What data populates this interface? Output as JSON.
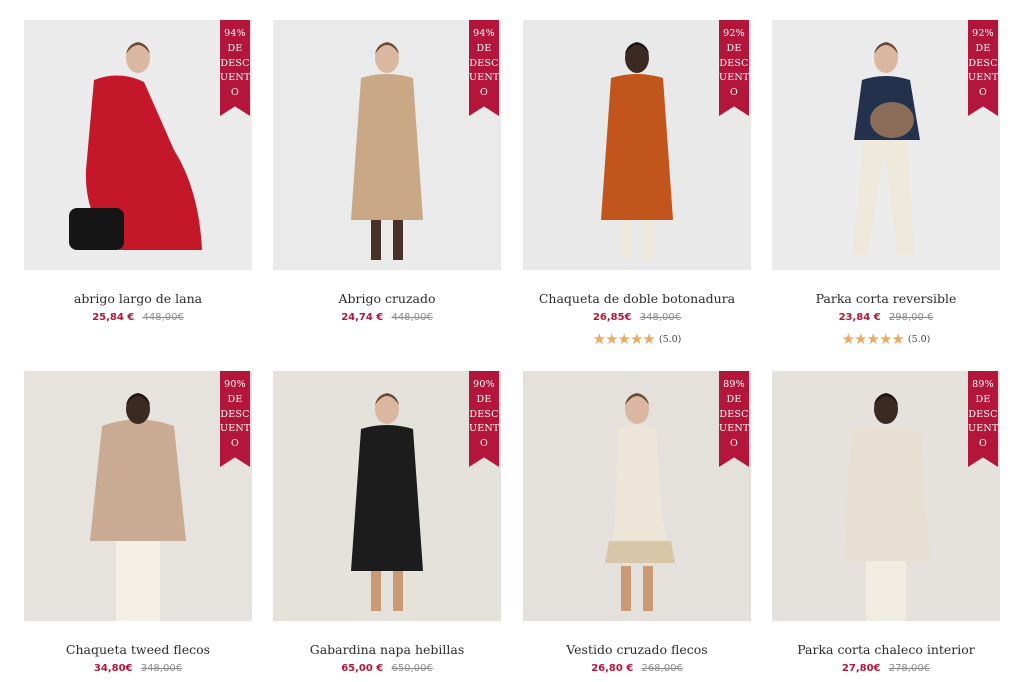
{
  "products": [
    {
      "name": "abrigo largo de lana",
      "price": "25,84 €",
      "old_price": "448,00€",
      "discount": [
        "94%",
        "DE",
        "DESC",
        "UENT",
        "O"
      ],
      "coat_color": "#c4182a",
      "bg": "#ebebeb",
      "rating": null
    },
    {
      "name": "Abrigo cruzado",
      "price": "24,74 €",
      "old_price": "448,00€",
      "discount": [
        "94%",
        "DE",
        "DESC",
        "UENT",
        "O"
      ],
      "coat_color": "#c9a886",
      "bg": "#eaeaea",
      "rating": null
    },
    {
      "name": "Chaqueta de doble botonadura",
      "price": "26,85€",
      "old_price": "348,00€",
      "discount": [
        "92%",
        "DE",
        "DESC",
        "UENT",
        "O"
      ],
      "coat_color": "#c2551c",
      "bg": "#e9e9e9",
      "rating": {
        "stars": "★★★★★",
        "score": "(5.0)"
      }
    },
    {
      "name": "Parka corta reversible",
      "price": "23,84 €",
      "old_price": "298,00 €",
      "discount": [
        "92%",
        "DE",
        "DESC",
        "UENT",
        "O"
      ],
      "coat_color": "#23314d",
      "bg": "#ebebeb",
      "rating": {
        "stars": "★★★★★",
        "score": "(5.0)"
      }
    },
    {
      "name": "Chaqueta tweed flecos",
      "price": "34,80€",
      "old_price": "348,00€",
      "discount": [
        "90%",
        "DE",
        "DESC",
        "UENT",
        "O"
      ],
      "coat_color": "#c9ab94",
      "bg": "#e6e2dd",
      "rating": null
    },
    {
      "name": "Gabardina napa hebillas",
      "price": "65,00 €",
      "old_price": "650,00€",
      "discount": [
        "90%",
        "DE",
        "DESC",
        "UENT",
        "O"
      ],
      "coat_color": "#1c1c1c",
      "bg": "#e5e2dc",
      "rating": null
    },
    {
      "name": "Vestido cruzado flecos",
      "price": "26,80 €",
      "old_price": "268,00€",
      "discount": [
        "89%",
        "DE",
        "DESC",
        "UENT",
        "O"
      ],
      "coat_color": "#ede6d8",
      "bg": "#e4e1dc",
      "rating": null
    },
    {
      "name": "Parka corta chaleco interior",
      "price": "27,80€",
      "old_price": "278,00€",
      "discount": [
        "89%",
        "DE",
        "DESC",
        "UENT",
        "O"
      ],
      "coat_color": "#e7e0d2",
      "bg": "#e5e2dd",
      "rating": null
    }
  ]
}
